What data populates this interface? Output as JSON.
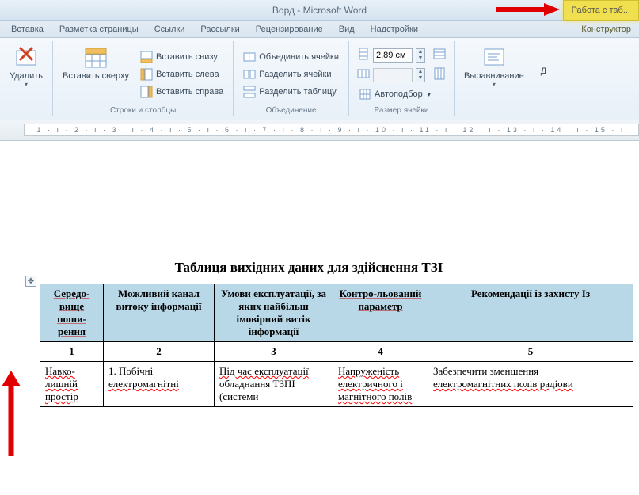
{
  "titlebar": {
    "title": "Ворд - Microsoft Word",
    "context_tab": "Работа с таб..."
  },
  "tabs": {
    "items": [
      "Вставка",
      "Разметка страницы",
      "Ссылки",
      "Рассылки",
      "Рецензирование",
      "Вид",
      "Надстройки"
    ],
    "context": "Конструктор"
  },
  "ribbon": {
    "delete": {
      "label": "Удалить"
    },
    "rows_cols": {
      "insert_top": "Вставить сверху",
      "insert_bottom": "Вставить снизу",
      "insert_left": "Вставить слева",
      "insert_right": "Вставить справа",
      "group_label": "Строки и столбцы"
    },
    "merge": {
      "merge_cells": "Объединить ячейки",
      "split_cells": "Разделить ячейки",
      "split_table": "Разделить таблицу",
      "group_label": "Объединение"
    },
    "cellsize": {
      "width_value": "2,89 см",
      "autofit": "Автоподбор",
      "group_label": "Размер ячейки"
    },
    "align": {
      "label": "Выравнивание"
    },
    "data_label": "Д"
  },
  "ruler_text": "· 1 · ı · 2 · ı · 3 · ı · 4 · ı · 5 · ı · 6 · ı · 7 · ı · 8 · ı · 9 · ı · 10 · ı · 11 · ı · 12 · ı · 13 · ı · 14 · ı · 15 · ı",
  "document": {
    "title": "Таблиця вихідних даних для здійснення ТЗІ",
    "anchor_glyph": "✥",
    "headers": [
      "Середо-вище поши-рення",
      "Можливий канал витоку інформації",
      "Умови експлуатації, за яких найбільш імовірний витік інформації",
      "Контро-льований параметр",
      "Рекомендації із захисту Із"
    ],
    "numbers": [
      "1",
      "2",
      "3",
      "4",
      "5"
    ],
    "row1": {
      "c1a": "Навко-",
      "c1b": "лишній",
      "c1c": "простір",
      "c2a": "1. Побічні",
      "c2b": "електромагнітні",
      "c3a": "Під час експлуатації",
      "c3b": "обладнання ТЗПІ",
      "c3c": "(системи",
      "c4a": "Напруженість",
      "c4b": "електричного і",
      "c4c": "магнітного полів",
      "c5a": "Забезпечити зменшення",
      "c5b": "електромагнітних полів радіови"
    }
  }
}
